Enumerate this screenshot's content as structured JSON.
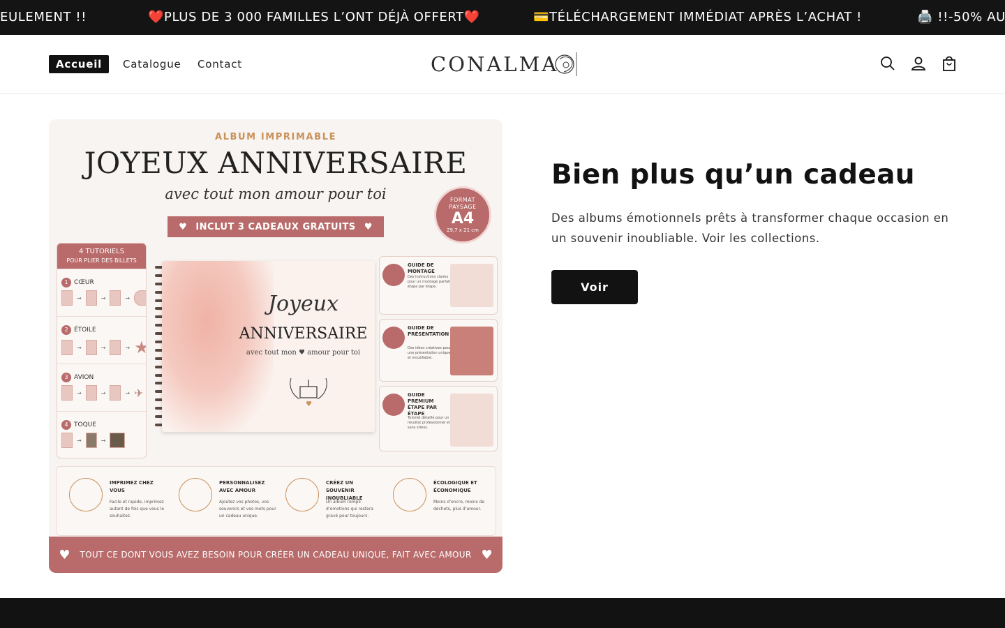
{
  "announcement": {
    "messages": [
      "EULEMENT !!",
      "❤️PLUS DE 3 000 FAMILLES L’ONT DÉJÀ OFFERT❤️",
      "💳TÉLÉCHARGEMENT IMMÉDIAT APRÈS L’ACHAT !",
      "🖨️ !!-50% AU"
    ]
  },
  "header": {
    "nav": [
      "Accueil",
      "Catalogue",
      "Contact"
    ],
    "logo_text": "CONALMA",
    "icons": [
      "search-icon",
      "account-icon",
      "cart-icon"
    ]
  },
  "product_image": {
    "kicker": "ALBUM IMPRIMABLE",
    "title": "JOYEUX ANNIVERSAIRE",
    "subtitle": "avec tout mon amour pour toi",
    "ribbon": "INCLUT 3 CADEAUX GRATUITS",
    "badge": {
      "line1": "FORMAT",
      "line2": "PAYSAGE",
      "size": "A4",
      "dims": "29,7 x 21 cm"
    },
    "tutorials": {
      "title": "4 TUTORIELS",
      "subtitle": "POUR PLIER DES BILLETS",
      "steps": [
        {
          "num": "1",
          "label": "CŒUR"
        },
        {
          "num": "2",
          "label": "ÉTOILE"
        },
        {
          "num": "3",
          "label": "AVION"
        },
        {
          "num": "4",
          "label": "TOQUE"
        }
      ]
    },
    "book": {
      "line1": "Joyeux",
      "line2": "ANNIVERSAIRE",
      "line3": "avec tout mon ♥ amour pour toi"
    },
    "guides": [
      {
        "title": "GUIDE DE MONTAGE",
        "desc": "Des instructions claires pour un montage parfait étape par étape."
      },
      {
        "title": "GUIDE DE PRÉSENTATION",
        "desc": "Des idées créatives pour une présentation unique et inoubliable."
      },
      {
        "title": "GUIDE PREMIUM ÉTAPE PAR ÉTAPE",
        "desc": "Tutoriel détaillé pour un résultat professionnel et sans stress."
      }
    ],
    "features": [
      {
        "title": "IMPRIMEZ CHEZ VOUS",
        "desc": "Facile et rapide, imprimez autant de fois que vous le souhaitez."
      },
      {
        "title": "PERSONNALISEZ AVEC AMOUR",
        "desc": "Ajoutez vos photos, vos souvenirs et vos mots pour un cadeau unique."
      },
      {
        "title": "CRÉEZ UN SOUVENIR INOUBLIABLE",
        "desc": "Un album rempli d’émotions qui restera gravé pour toujours."
      },
      {
        "title": "ÉCOLOGIQUE ET ÉCONOMIQUE",
        "desc": "Moins d’encre, moins de déchets, plus d’amour."
      }
    ],
    "footer": "TOUT CE DONT VOUS AVEZ BESOIN POUR CRÉER UN CADEAU UNIQUE, FAIT AVEC AMOUR"
  },
  "hero": {
    "title": "Bien plus qu’un cadeau",
    "description": "Des albums émotionnels prêts à transformer chaque occasion en un souvenir inoubliable. Voir les collections.",
    "button": "Voir"
  },
  "colors": {
    "dark": "#121212",
    "accent_rose": "#b86b6a",
    "gold": "#c9925a"
  }
}
